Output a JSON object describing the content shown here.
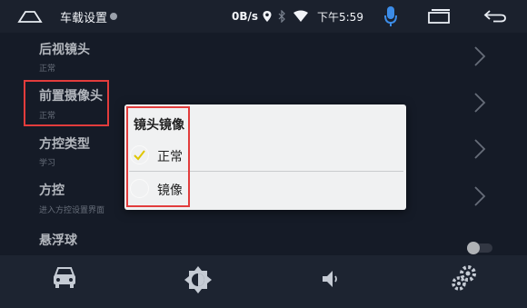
{
  "statusbar": {
    "title": "车载设置",
    "net_speed": "0B/s",
    "time": "下午5:59"
  },
  "settings": {
    "rows": [
      {
        "label": "后视镜头",
        "sub": "正常"
      },
      {
        "label": "前置摄像头",
        "sub": "正常"
      },
      {
        "label": "方控类型",
        "sub": "学习"
      },
      {
        "label": "方控",
        "sub": "进入方控设置界面"
      },
      {
        "label": "悬浮球",
        "sub": ""
      }
    ]
  },
  "dialog": {
    "title": "镜头镜像",
    "options": [
      {
        "label": "正常",
        "selected": true
      },
      {
        "label": "镜像",
        "selected": false
      }
    ]
  },
  "bottom_tabs": [
    "car-icon",
    "brightness-icon",
    "volume-icon",
    "settings-gears-icon"
  ],
  "colors": {
    "background": "#1a2130",
    "dialog": "#f0f1f2",
    "highlight": "#e23c3c",
    "check": "#e0c600",
    "mic": "#3c8ce7"
  }
}
